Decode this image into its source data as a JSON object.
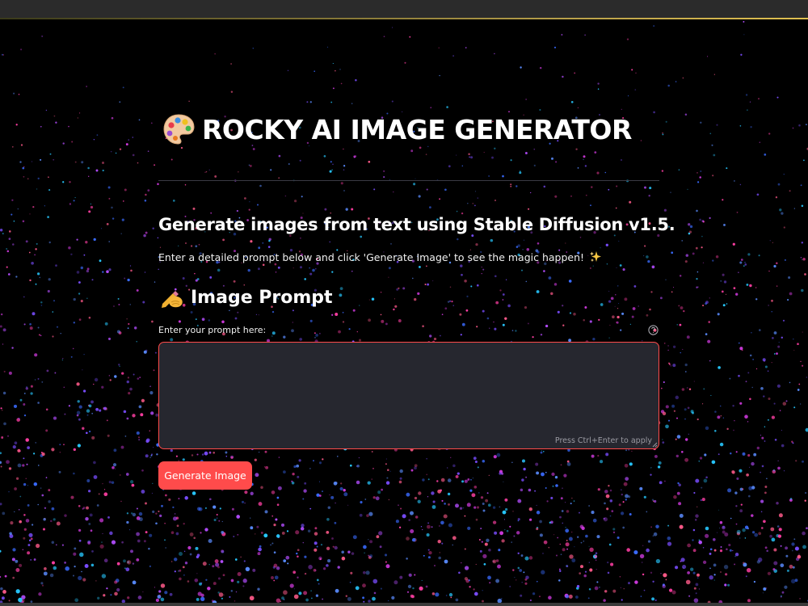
{
  "app": {
    "title": "ROCKY AI IMAGE GENERATOR",
    "subtitle": "Generate images from text using Stable Diffusion v1.5.",
    "description": "Enter a detailed prompt below and click 'Generate Image' to see the magic happen!"
  },
  "prompt_section": {
    "heading": "Image Prompt",
    "field_label": "Enter your prompt here:",
    "value": "",
    "hint": "Press Ctrl+Enter to apply"
  },
  "actions": {
    "generate_label": "Generate Image"
  },
  "icons": {
    "title_icon": "palette-icon",
    "description_icon": "sparkles-icon",
    "section_icon": "writing-hand-icon",
    "help_icon": "help-circle-icon"
  },
  "colors": {
    "background": "#000000",
    "accent": "#ff4b4b",
    "input_background": "#26272f",
    "text": "#ffffff"
  }
}
